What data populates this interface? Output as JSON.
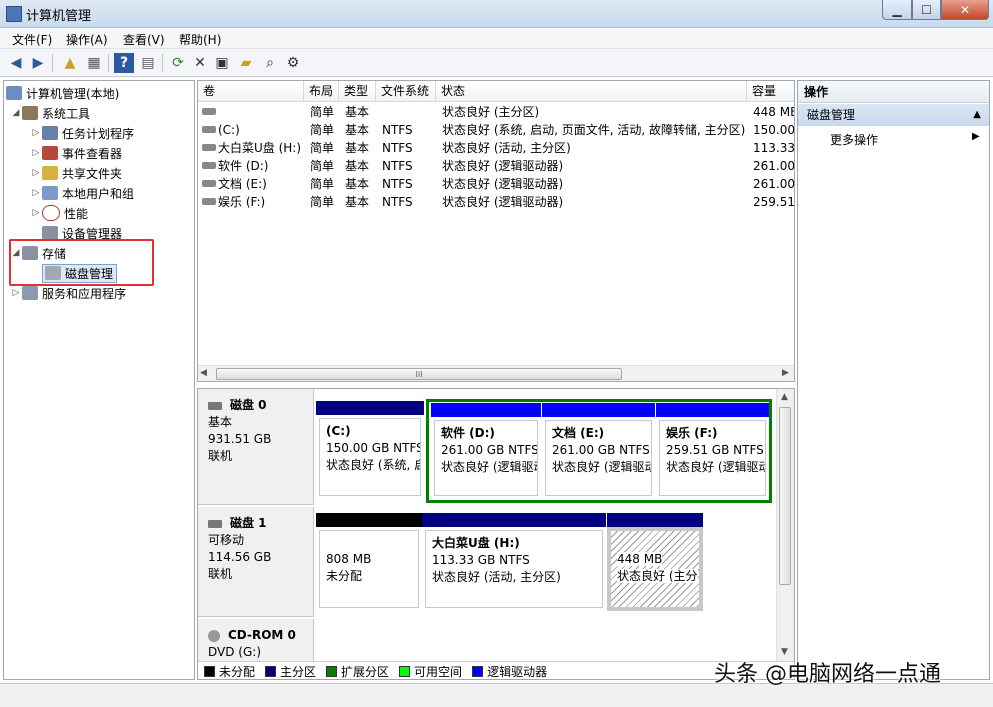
{
  "window": {
    "title": "计算机管理"
  },
  "menu": [
    "文件(F)",
    "操作(A)",
    "查看(V)",
    "帮助(H)"
  ],
  "toolbar_icons": [
    "back-icon",
    "forward-icon",
    "up-icon",
    "show-hide-tree-icon",
    "help-icon",
    "console-icon",
    "refresh-icon",
    "delete-icon",
    "properties-icon",
    "open-icon",
    "find-icon",
    "settings-icon"
  ],
  "tree": {
    "root": "计算机管理(本地)",
    "system_tools": "系统工具",
    "items": [
      "任务计划程序",
      "事件查看器",
      "共享文件夹",
      "本地用户和组",
      "性能",
      "设备管理器"
    ],
    "storage": "存储",
    "disk_mgmt": "磁盘管理",
    "services": "服务和应用程序"
  },
  "volume_table": {
    "headers": [
      "卷",
      "布局",
      "类型",
      "文件系统",
      "状态",
      "容量"
    ],
    "rows": [
      {
        "vol": "",
        "layout": "简单",
        "type": "基本",
        "fs": "",
        "status": "状态良好 (主分区)",
        "cap": "448 MB"
      },
      {
        "vol": "(C:)",
        "layout": "简单",
        "type": "基本",
        "fs": "NTFS",
        "status": "状态良好 (系统, 启动, 页面文件, 活动, 故障转储, 主分区)",
        "cap": "150.00"
      },
      {
        "vol": "大白菜U盘 (H:)",
        "layout": "简单",
        "type": "基本",
        "fs": "NTFS",
        "status": "状态良好 (活动, 主分区)",
        "cap": "113.33"
      },
      {
        "vol": "软件 (D:)",
        "layout": "简单",
        "type": "基本",
        "fs": "NTFS",
        "status": "状态良好 (逻辑驱动器)",
        "cap": "261.00"
      },
      {
        "vol": "文档 (E:)",
        "layout": "简单",
        "type": "基本",
        "fs": "NTFS",
        "status": "状态良好 (逻辑驱动器)",
        "cap": "261.00"
      },
      {
        "vol": "娱乐 (F:)",
        "layout": "简单",
        "type": "基本",
        "fs": "NTFS",
        "status": "状态良好 (逻辑驱动器)",
        "cap": "259.51"
      }
    ],
    "scroll_mark": "III"
  },
  "disks": {
    "disk0": {
      "name": "磁盘 0",
      "type": "基本",
      "size": "931.51 GB",
      "state": "联机",
      "parts": [
        {
          "name": "(C:)",
          "size": "150.00 GB NTFS",
          "status": "状态良好 (系统, 启"
        },
        {
          "name": "软件  (D:)",
          "size": "261.00 GB NTFS",
          "status": "状态良好 (逻辑驱动"
        },
        {
          "name": "文档  (E:)",
          "size": "261.00 GB NTFS",
          "status": "状态良好 (逻辑驱动"
        },
        {
          "name": "娱乐  (F:)",
          "size": "259.51 GB NTFS",
          "status": "状态良好 (逻辑驱动"
        }
      ]
    },
    "disk1": {
      "name": "磁盘 1",
      "type": "可移动",
      "size": "114.56 GB",
      "state": "联机",
      "parts": [
        {
          "name": "",
          "size": "808 MB",
          "status": "未分配"
        },
        {
          "name": "大白菜U盘  (H:)",
          "size": "113.33 GB NTFS",
          "status": "状态良好 (活动, 主分区)"
        },
        {
          "name": "",
          "size": "448 MB",
          "status": "状态良好 (主分"
        }
      ]
    },
    "cdrom": {
      "name": "CD-ROM 0",
      "type": "DVD (G:)"
    }
  },
  "legend": [
    "未分配",
    "主分区",
    "扩展分区",
    "可用空间",
    "逻辑驱动器"
  ],
  "colors": {
    "unallocated": "#000000",
    "primary": "#000080",
    "extended": "#008000",
    "free": "#00ff00",
    "logical": "#0000ff"
  },
  "actions": {
    "header": "操作",
    "section": "磁盘管理",
    "more": "更多操作"
  },
  "watermark": "头条 @电脑网络一点通"
}
